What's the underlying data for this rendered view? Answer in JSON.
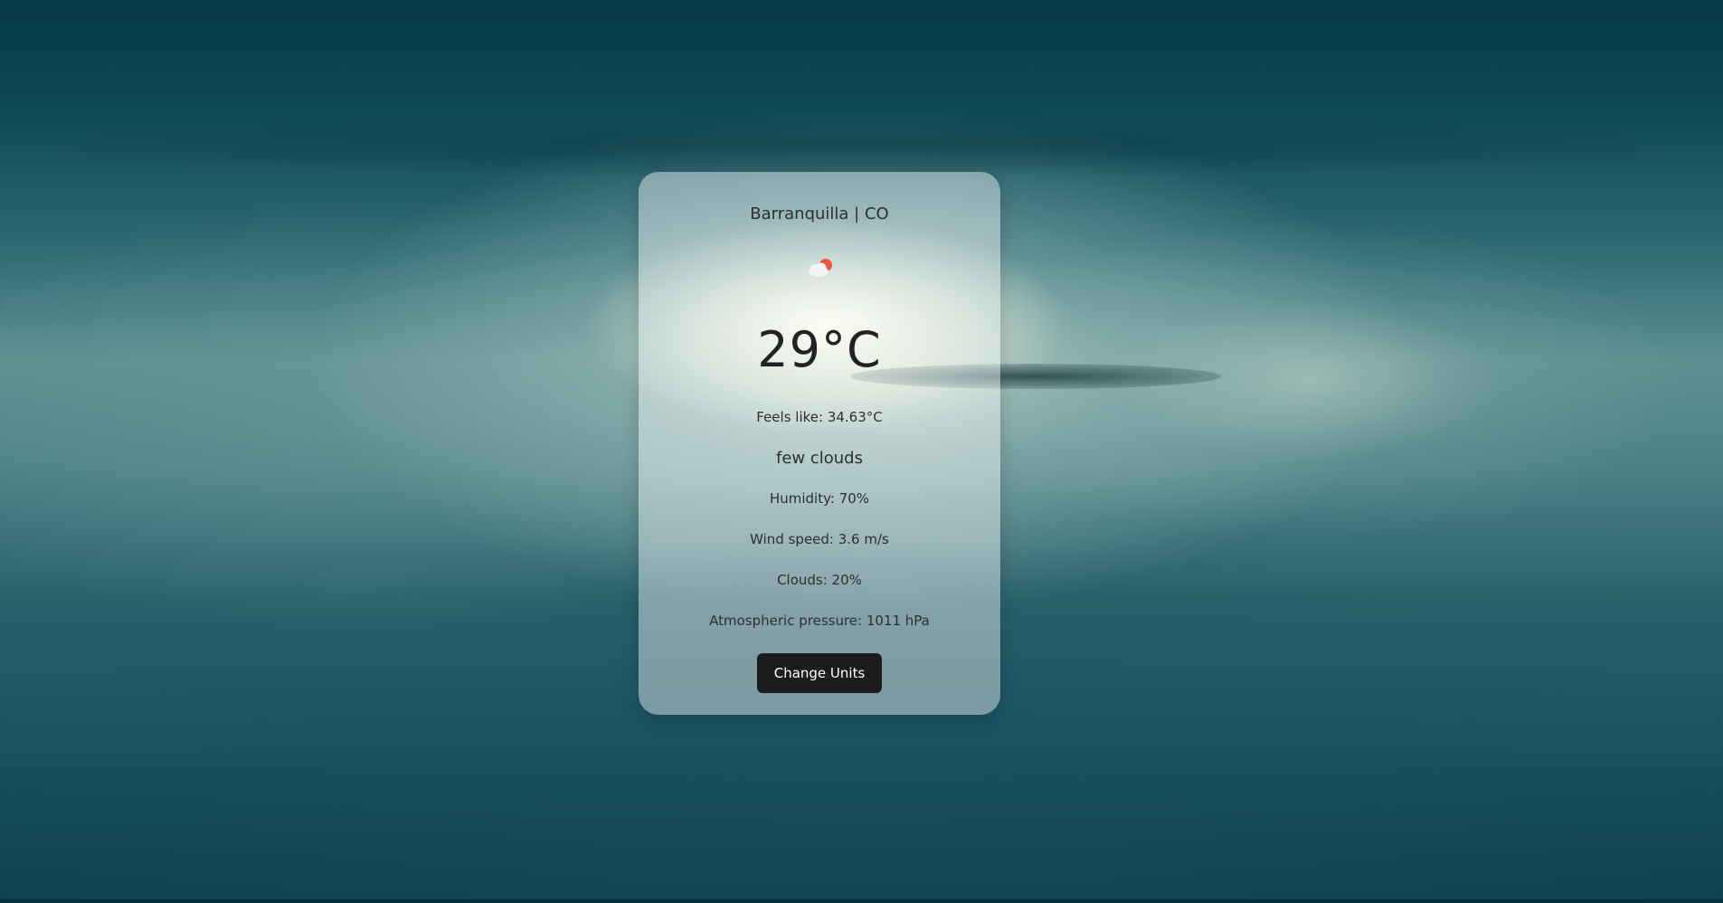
{
  "weather": {
    "location": "Barranquilla | CO",
    "icon": "few-clouds-day-icon",
    "temperature": "29°C",
    "feels_like": "Feels like: 34.63°C",
    "description": "few clouds",
    "humidity": "Humidity: 70%",
    "wind_speed": "Wind speed: 3.6 m/s",
    "clouds": "Clouds: 20%",
    "pressure": "Atmospheric pressure: 1011 hPa"
  },
  "actions": {
    "change_units_label": "Change Units"
  },
  "colors": {
    "card_background": "#ffffff6b",
    "button_background": "#1c1c1c",
    "button_text": "#ffffff",
    "sun": "#e9573f"
  }
}
